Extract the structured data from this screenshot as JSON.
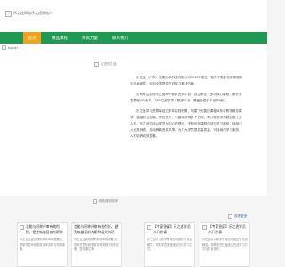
{
  "header": {
    "logo_alt": "乐之途网络乐之途网络人"
  },
  "nav": {
    "items": [
      {
        "label": "首页",
        "active": true
      },
      {
        "label": "精品课程",
        "active": false
      },
      {
        "label": "师资力量",
        "active": false
      },
      {
        "label": "联系我们",
        "active": false
      }
    ],
    "color": "#1e9a52",
    "active_color": "#f0a419"
  },
  "banner": {
    "alt": "banner"
  },
  "about": {
    "title_alt": "走进乐之途",
    "paragraphs": [
      "乐之途（广东）信息技术科技有限公司2012年成立，致力于数字化教育服务与技术研发，面向全国提供在线学习解决方案。",
      "公司专注建设乐之途APP数字资源平台，自主研发了多项核心课程，累计开发课程450余节，APP注册学员人数逾51万，覆盖全国多个省市地区。",
      "乐之途学习资源库经过多年实践积累，构建了完善的课程体系与教学服务模式，涵盖职业技能、学历提升、兴趣培养等多个方向，累计服务学员超过数十万人次。乐之途坚持以学员为中心的理念，不断优化课程内容与学习体验，持续引入优秀师资，推动教育资源共享，为广大学员提供高质量、可持续的学习服务，人才培养成效显著。"
    ]
  },
  "products": {
    "title_alt": "精选课程推荐",
    "more_label": "查看更多+",
    "cards": [
      {
        "title": "怎能与职称评审有效衔接，避免缩量提前考职称相关知识",
        "body": "乐之途全面梳理职称评审政策要点，帮助学员系统掌握评审流程与材料准备。"
      },
      {
        "title": "怎能与职称评审有效衔接，避免缩量提前考职称相关知识",
        "body": "乐之途全面梳理职称评审政策要点，帮助学员系统掌握评审流程与材料准备，提升通过率。"
      },
      {
        "title": "【专家答疑】乐之途学员入门必读",
        "body": "乐之途针对新学员常见问题进行系统解答，帮助学员快速适应在线学习方式。"
      },
      {
        "title": "【专家答疑】乐之途学员入门必读",
        "body": "乐之途针对新学员常见问题进行系统解答，帮助学员快速适应在线学习方式与平台操作。"
      }
    ]
  }
}
